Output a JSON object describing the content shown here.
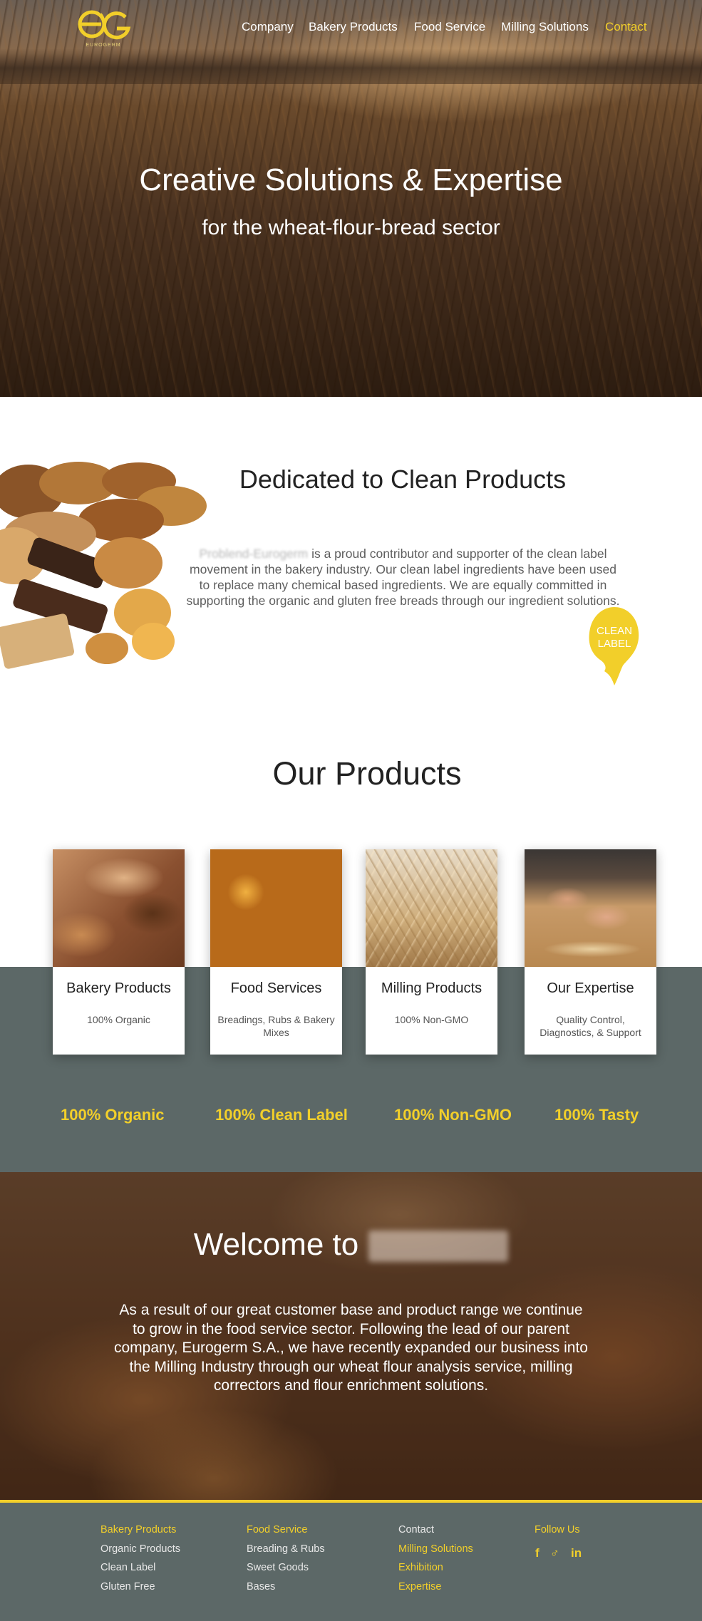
{
  "header": {
    "logo_text": "EUROGERM",
    "nav": [
      {
        "label": "Company"
      },
      {
        "label": "Bakery Products"
      },
      {
        "label": "Food Service"
      },
      {
        "label": "Milling Solutions"
      },
      {
        "label": "Contact",
        "active": true
      }
    ]
  },
  "hero": {
    "title": "Creative Solutions & Expertise",
    "subtitle": "for the wheat-flour-bread sector"
  },
  "clean": {
    "title": "Dedicated to Clean Products",
    "company_blurred": "Problend-Eurogerm",
    "text": " is a proud contributor and supporter of the clean label movement in the bakery industry. Our clean label ingredients have been used to replace many chemical based ingredients. We are equally committed in supporting the organic and gluten free breads through our ingredient solutions.",
    "badge": [
      "CLEAN",
      "LABEL"
    ]
  },
  "products": {
    "title": "Our Products",
    "cards": [
      {
        "title": "Bakery Products",
        "desc": "100% Organic"
      },
      {
        "title": "Food Services",
        "desc": "Breadings, Rubs & Bakery Mixes"
      },
      {
        "title": "Milling Products",
        "desc": "100% Non-GMO"
      },
      {
        "title": "Our Expertise",
        "desc": "Quality Control, Diagnostics, & Support"
      }
    ],
    "stats": [
      "100% Organic",
      "100% Clean Label",
      "100% Non-GMO",
      "100% Tasty"
    ]
  },
  "welcome": {
    "title": "Welcome to",
    "text": "As a result of our great customer base and product range we continue to grow in the food service sector. Following the lead of our parent company, Eurogerm S.A., we have recently expanded our business into the Milling Industry through our wheat flour analysis service, milling correctors and flour enrichment solutions."
  },
  "footer": {
    "col1": [
      "Bakery Products",
      "Organic Products",
      "Clean Label",
      "Gluten Free"
    ],
    "col2": [
      "Food Service",
      "Breading & Rubs",
      "Sweet Goods",
      "Bases"
    ],
    "col3": [
      "Contact",
      "Milling Solutions",
      "Exhibition",
      "Expertise"
    ],
    "follow": "Follow Us",
    "social": [
      "f",
      "♂",
      "in"
    ]
  },
  "colors": {
    "accent": "#f2cf2a",
    "band": "#5c6867"
  }
}
